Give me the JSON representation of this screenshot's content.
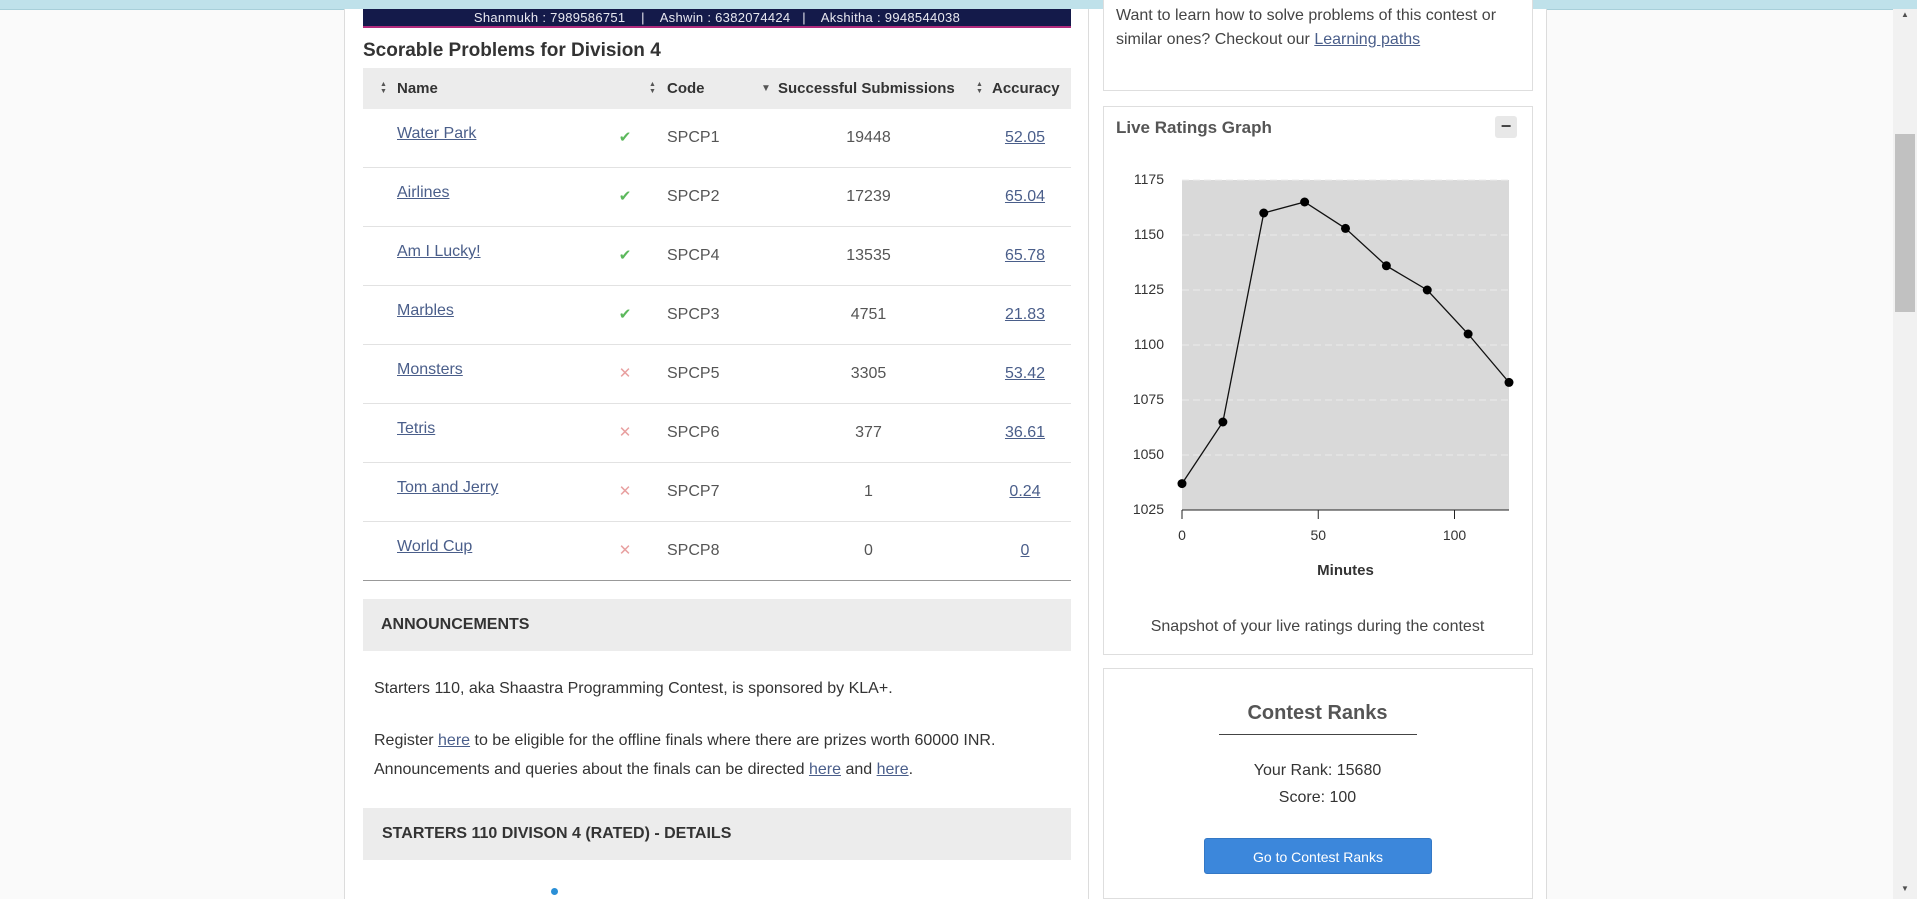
{
  "banner": {
    "text": "Shanmukh : 7989586751    |    Ashwin : 6382074424   |    Akshitha : 9948544038"
  },
  "problems_section": {
    "title": "Scorable Problems for Division 4",
    "headers": {
      "name": "Name",
      "code": "Code",
      "subs": "Successful Submissions",
      "accuracy": "Accuracy"
    },
    "rows": [
      {
        "name": "Water Park",
        "status": "solved",
        "code": "SPCP1",
        "subs": "19448",
        "acc": "52.05"
      },
      {
        "name": "Airlines",
        "status": "solved",
        "code": "SPCP2",
        "subs": "17239",
        "acc": "65.04"
      },
      {
        "name": "Am I Lucky!",
        "status": "solved",
        "code": "SPCP4",
        "subs": "13535",
        "acc": "65.78"
      },
      {
        "name": "Marbles",
        "status": "solved",
        "code": "SPCP3",
        "subs": "4751",
        "acc": "21.83"
      },
      {
        "name": "Monsters",
        "status": "unsolved",
        "code": "SPCP5",
        "subs": "3305",
        "acc": "53.42"
      },
      {
        "name": "Tetris",
        "status": "unsolved",
        "code": "SPCP6",
        "subs": "377",
        "acc": "36.61"
      },
      {
        "name": "Tom and Jerry",
        "status": "unsolved",
        "code": "SPCP7",
        "subs": "1",
        "acc": "0.24"
      },
      {
        "name": "World Cup",
        "status": "unsolved",
        "code": "SPCP8",
        "subs": "0",
        "acc": "0"
      }
    ],
    "status_icons": {
      "solved": "check-icon",
      "unsolved": "cross-icon"
    }
  },
  "announcements": {
    "header": "ANNOUNCEMENTS",
    "p1": "Starters 110, aka Shaastra Programming Contest, is sponsored by KLA+.",
    "p2": {
      "t1": "Register ",
      "link1": "here",
      "t2": " to be eligible for the offline finals where there are prizes worth 60000 INR.",
      "t3": "Announcements and queries about the finals can be directed ",
      "link2": "here",
      "t4": " and ",
      "link3": "here",
      "t5": "."
    }
  },
  "details": {
    "header": "STARTERS 110 DIVISON 4 (RATED) - DETAILS"
  },
  "sidebar": {
    "learn_text": "Want to learn how to solve problems of this contest or similar ones? Checkout our ",
    "learn_link": "Learning paths",
    "graph_title": "Live Ratings Graph",
    "collapse_symbol": "−",
    "graph_caption": "Snapshot of your live ratings during the contest",
    "ranks_title": "Contest Ranks",
    "your_rank": "Your Rank: 15680",
    "score": "Score: 100",
    "ranks_button": "Go to Contest Ranks"
  },
  "colors": {
    "accent_button": "#3c87db",
    "link": "#4a5e8a",
    "solved": "#5cb85c",
    "unsolved": "#e8a0a0",
    "banner": "#141a4a"
  },
  "chart_data": {
    "type": "line",
    "title": "",
    "xlabel": "Minutes",
    "ylabel": "",
    "x": [
      0,
      15,
      30,
      45,
      60,
      75,
      90,
      105,
      120
    ],
    "series": [
      {
        "values": [
          1037,
          1065,
          1160,
          1165,
          1153,
          1136,
          1125,
          1105,
          1083
        ]
      }
    ],
    "xlim": [
      0,
      120
    ],
    "ylim": [
      1025,
      1175
    ],
    "xticks": [
      "0",
      "50",
      "100"
    ],
    "yticks": [
      "1025",
      "1050",
      "1075",
      "1100",
      "1125",
      "1150",
      "1175"
    ],
    "grid": true
  }
}
